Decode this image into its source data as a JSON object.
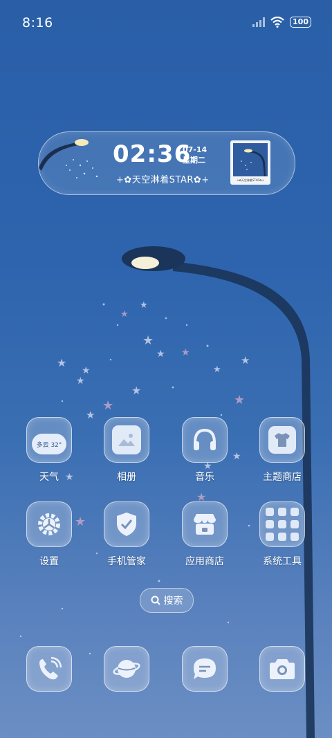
{
  "status_bar": {
    "time": "8:16",
    "battery": "100"
  },
  "widget": {
    "time": "02:36",
    "date": "07-14",
    "weekday": "星期二",
    "caption": "+✿天空淋着STAR✿+",
    "photo_caption": "+✿天空淋着STAR✿+"
  },
  "apps_row1": [
    {
      "label": "天气",
      "icon": "weather-icon",
      "weather_text": "多云 32°"
    },
    {
      "label": "相册",
      "icon": "gallery-icon"
    },
    {
      "label": "音乐",
      "icon": "headphones-icon"
    },
    {
      "label": "主题商店",
      "icon": "tshirt-icon"
    }
  ],
  "apps_row2": [
    {
      "label": "设置",
      "icon": "gear-icon"
    },
    {
      "label": "手机管家",
      "icon": "shield-check-icon"
    },
    {
      "label": "应用商店",
      "icon": "store-icon"
    },
    {
      "label": "系统工具",
      "icon": "folder-icon"
    }
  ],
  "search": {
    "label": "搜索"
  },
  "dock": [
    {
      "icon": "phone-icon"
    },
    {
      "icon": "browser-planet-icon"
    },
    {
      "icon": "message-icon"
    },
    {
      "icon": "camera-icon"
    }
  ]
}
